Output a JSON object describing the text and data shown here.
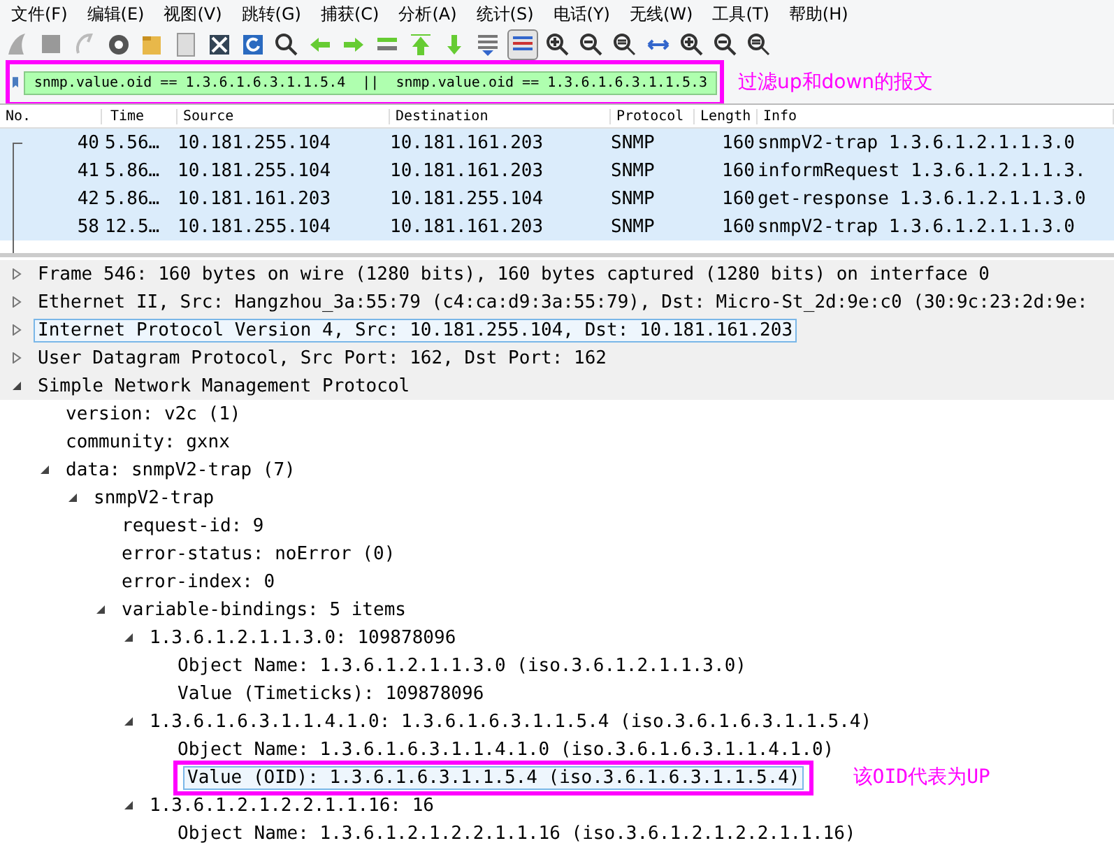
{
  "menu": [
    "文件(F)",
    "编辑(E)",
    "视图(V)",
    "跳转(G)",
    "捕获(C)",
    "分析(A)",
    "统计(S)",
    "电话(Y)",
    "无线(W)",
    "工具(T)",
    "帮助(H)"
  ],
  "filter": {
    "value": "snmp.value.oid == 1.3.6.1.6.3.1.1.5.4  ||  snmp.value.oid == 1.3.6.1.6.3.1.1.5.3",
    "note": "过滤up和down的报文"
  },
  "packet_list": {
    "columns": [
      "No.",
      "Time",
      "Source",
      "Destination",
      "Protocol",
      "Length",
      "Info"
    ],
    "rows": [
      {
        "cells": [
          "40",
          "5.56…",
          "10.181.255.104",
          "10.181.161.203",
          "SNMP",
          "160",
          "snmpV2-trap 1.3.6.1.2.1.1.3.0"
        ]
      },
      {
        "cells": [
          "41",
          "5.86…",
          "10.181.255.104",
          "10.181.161.203",
          "SNMP",
          "160",
          "informRequest 1.3.6.1.2.1.1.3."
        ]
      },
      {
        "cells": [
          "42",
          "5.86…",
          "10.181.161.203",
          "10.181.255.104",
          "SNMP",
          "160",
          "get-response 1.3.6.1.2.1.1.3.0"
        ]
      },
      {
        "cells": [
          "58",
          "12.5…",
          "10.181.255.104",
          "10.181.161.203",
          "SNMP",
          "160",
          "snmpV2-trap 1.3.6.1.2.1.1.3.0"
        ]
      }
    ]
  },
  "details": [
    {
      "text": "Frame 546: 160 bytes on wire (1280 bits), 160 bytes captured (1280 bits) on interface 0",
      "expanded": false,
      "selected": false
    },
    {
      "text": "Ethernet II, Src: Hangzhou_3a:55:79 (c4:ca:d9:3a:55:79), Dst: Micro-St_2d:9e:c0 (30:9c:23:2d:9e:",
      "expanded": false,
      "selected": false
    },
    {
      "text": "Internet Protocol Version 4, Src: 10.181.255.104, Dst: 10.181.161.203",
      "expanded": false,
      "selected": true
    },
    {
      "text": "User Datagram Protocol, Src Port: 162, Dst Port: 162",
      "expanded": false,
      "selected": false
    },
    {
      "text": "Simple Network Management Protocol",
      "expanded": true,
      "selected": false,
      "children": [
        {
          "text": "version: v2c (1)",
          "selected": false
        },
        {
          "text": "community: gxnx",
          "selected": false
        },
        {
          "text": "data: snmpV2-trap (7)",
          "expanded": true,
          "selected": false,
          "children": [
            {
              "text": "snmpV2-trap",
              "expanded": true,
              "selected": false,
              "children": [
                {
                  "text": "request-id: 9",
                  "selected": false
                },
                {
                  "text": "error-status: noError (0)",
                  "selected": false
                },
                {
                  "text": "error-index: 0",
                  "selected": false
                },
                {
                  "text": "variable-bindings: 5 items",
                  "expanded": true,
                  "selected": false,
                  "children": [
                    {
                      "text": "1.3.6.1.2.1.1.3.0: 109878096",
                      "expanded": true,
                      "selected": false,
                      "children": [
                        {
                          "text": "Object Name: 1.3.6.1.2.1.1.3.0 (iso.3.6.1.2.1.1.3.0)",
                          "selected": false
                        },
                        {
                          "text": "Value (Timeticks): 109878096",
                          "selected": false
                        }
                      ]
                    },
                    {
                      "text": "1.3.6.1.6.3.1.1.4.1.0: 1.3.6.1.6.3.1.1.5.4 (iso.3.6.1.6.3.1.1.5.4)",
                      "expanded": true,
                      "selected": false,
                      "children": [
                        {
                          "text": "Object Name: 1.3.6.1.6.3.1.1.4.1.0 (iso.3.6.1.6.3.1.1.4.1.0)",
                          "selected": false
                        },
                        {
                          "text": "Value (OID): 1.3.6.1.6.3.1.1.5.4 (iso.3.6.1.6.3.1.1.5.4)",
                          "selected": true,
                          "note": "该OID代表为UP"
                        }
                      ]
                    },
                    {
                      "text": "1.3.6.1.2.1.2.2.1.1.16: 16",
                      "expanded": true,
                      "selected": false,
                      "children": [
                        {
                          "text": "Object Name: 1.3.6.1.2.1.2.2.1.1.16 (iso.3.6.1.2.1.2.2.1.1.16)",
                          "selected": false
                        }
                      ]
                    }
                  ]
                }
              ]
            }
          ]
        }
      ]
    }
  ]
}
